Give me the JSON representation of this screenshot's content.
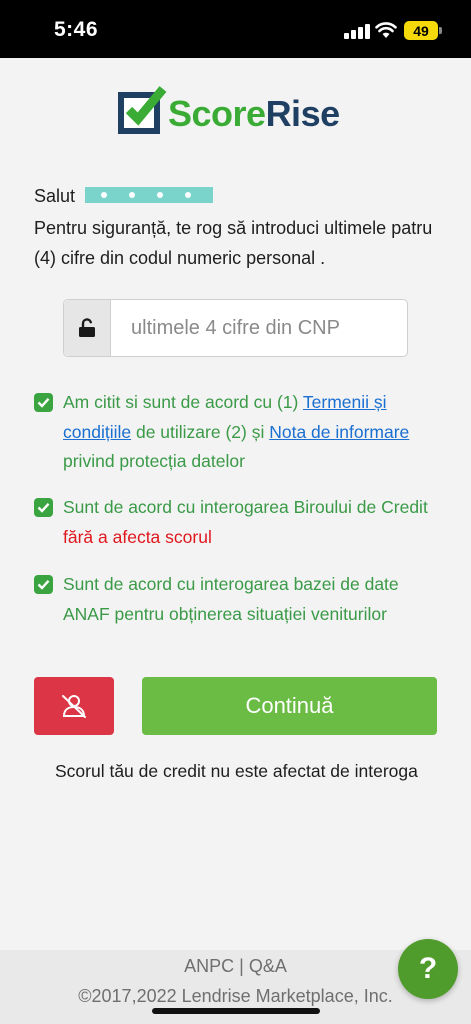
{
  "status_bar": {
    "time": "5:46",
    "battery": "49"
  },
  "brand": {
    "score": "Score",
    "rise": "Rise",
    "green": "#3aab35",
    "navy": "#1f3f63"
  },
  "greeting": {
    "salutation": "Salut"
  },
  "intro": {
    "text": "Pentru siguranță, te rog să introduci ultimele patru (4) cifre din codul numeric personal ."
  },
  "cnp": {
    "placeholder": "ultimele 4 cifre din CNP",
    "lock_icon": "unlock-icon"
  },
  "consents": {
    "terms": {
      "prefix": "Am citit si sunt de acord cu (1) ",
      "terms_link": "Termenii și condițiile",
      "middle": " de utilizare (2) și ",
      "notice_link": "Nota de informare",
      "suffix": " privind protecția datelor"
    },
    "bureau": {
      "text": "Sunt de acord cu interogarea Biroului de Credit ",
      "warning": "fără a afecta scorul"
    },
    "anaf": {
      "text": "Sunt de acord cu interogarea bazei de date ANAF pentru obținerea situației veniturilor"
    }
  },
  "actions": {
    "camera_icon": "camera-off-icon",
    "continue_label": "Continuă"
  },
  "info": {
    "text": "Scorul tău de credit nu este afectat de interoga"
  },
  "footer": {
    "anpc": "ANPC",
    "separator": "|",
    "qa": "Q&A",
    "copyright": "©2017,2022 Lendrise Marketplace, Inc."
  },
  "help": {
    "label": "?"
  },
  "colors": {
    "accent_green": "#6abc45",
    "danger_red": "#dc3545",
    "link_blue": "#1a6fd1",
    "checkbox_green": "#3aa540"
  }
}
